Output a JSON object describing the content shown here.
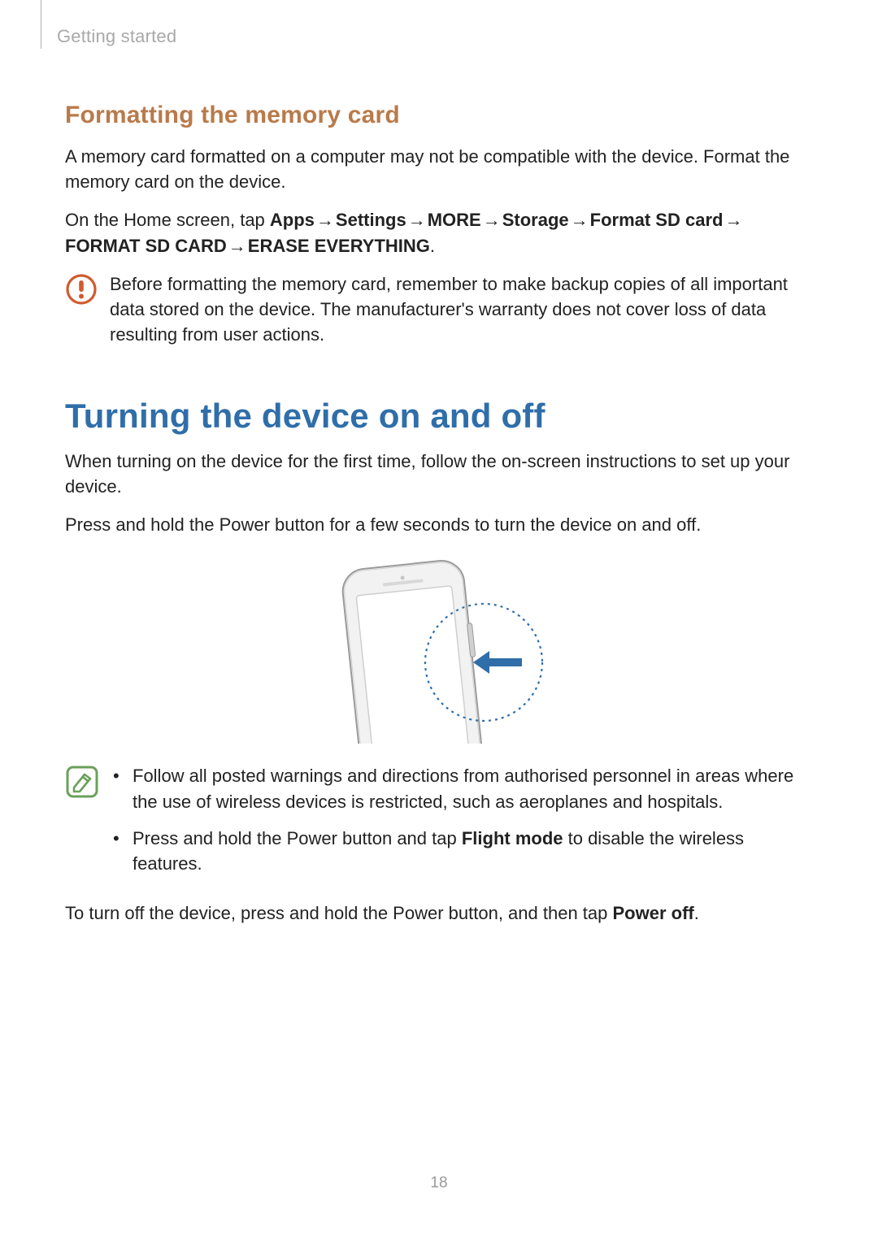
{
  "header": {
    "breadcrumb": "Getting started"
  },
  "section1": {
    "heading": "Formatting the memory card",
    "p1": "A memory card formatted on a computer may not be compatible with the device. Format the memory card on the device.",
    "nav": {
      "prefix": "On the Home screen, tap ",
      "arrow": "→",
      "steps": [
        "Apps",
        "Settings",
        "MORE",
        "Storage",
        "Format SD card",
        "FORMAT SD CARD",
        "ERASE EVERYTHING"
      ],
      "suffix": "."
    },
    "caution": "Before formatting the memory card, remember to make backup copies of all important data stored on the device. The manufacturer's warranty does not cover loss of data resulting from user actions."
  },
  "section2": {
    "heading": "Turning the device on and off",
    "p1": "When turning on the device for the first time, follow the on-screen instructions to set up your device.",
    "p2": "Press and hold the Power button for a few seconds to turn the device on and off.",
    "notes": {
      "item1": "Follow all posted warnings and directions from authorised personnel in areas where the use of wireless devices is restricted, such as aeroplanes and hospitals.",
      "item2_pre": "Press and hold the Power button and tap ",
      "item2_bold": "Flight mode",
      "item2_post": " to disable the wireless features."
    },
    "p3_pre": "To turn off the device, press and hold the Power button, and then tap ",
    "p3_bold": "Power off",
    "p3_post": "."
  },
  "page_number": "18",
  "icons": {
    "caution_color": "#cf5b2e",
    "note_color": "#6aa05a"
  }
}
